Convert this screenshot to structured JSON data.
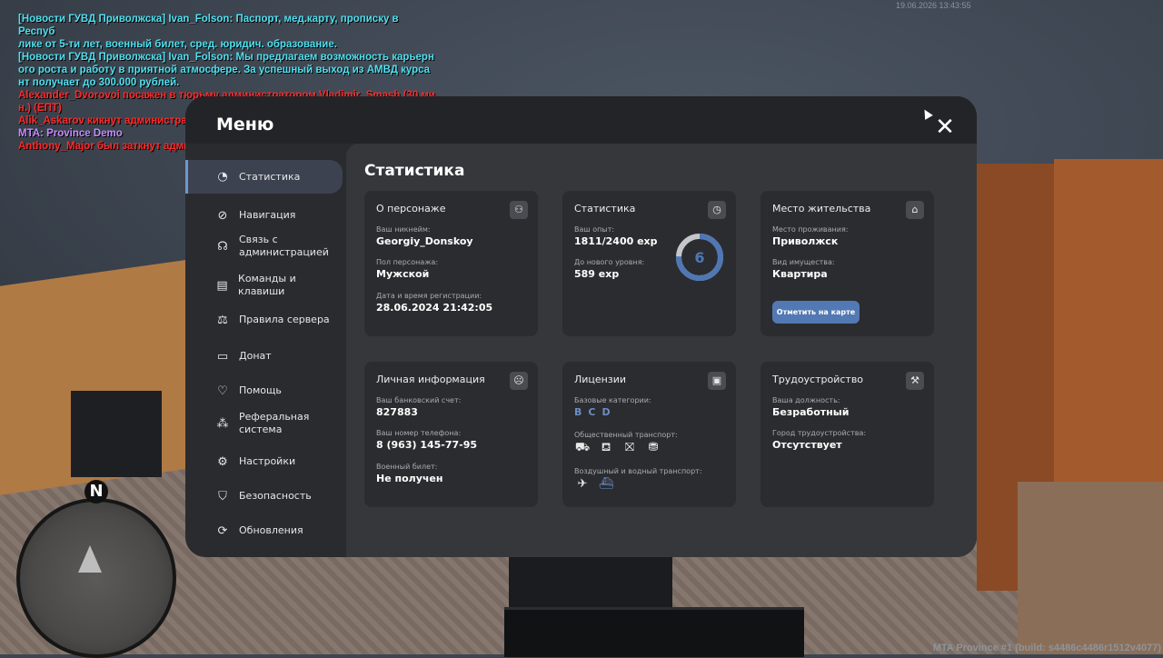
{
  "chat": [
    {
      "text": "[Новости ГУВД Приволжска] Ivan_Folson: Паспорт, мед.карту, прописку в Респуб",
      "color": "cyan"
    },
    {
      "text": "лике от 5-ти лет, военный билет, сред. юридич. образование.",
      "color": "cyan"
    },
    {
      "text": "[Новости ГУВД Приволжска] Ivan_Folson: Мы предлагаем возможность карьерн",
      "color": "cyan"
    },
    {
      "text": "ого роста и работу в приятной атмосфере. За успешный выход из АМВД курса",
      "color": "cyan"
    },
    {
      "text": "нт получает до 300.000 рублей.",
      "color": "cyan"
    },
    {
      "text": "Alexander_Dvorovoi посажен в тюрьму администратором Vladimir_Smash (30 ми",
      "color": "red"
    },
    {
      "text": "н.) (ЕПТ)",
      "color": "red"
    },
    {
      "text": "Alik_Askarov кикнут администратором Artem_Augustov (Сильные лаги)",
      "color": "red"
    },
    {
      "text": "MTA: Province Demo",
      "color": "purple"
    },
    {
      "text": "Anthony_Major был заткнут администратором Vladimir_Smash (30 мин.) (Caps)",
      "color": "red"
    }
  ],
  "top_time": "19.06.2026 13:43:55",
  "build": "MTA Province #1 (build: s4486c4486r1512v4077)",
  "radar": {
    "north": "N"
  },
  "menu": {
    "title": "Меню",
    "close": "✕"
  },
  "sidebar": {
    "items": [
      {
        "label": "Статистика",
        "icon": "pie-chart-icon",
        "glyph": "◔",
        "active": true
      },
      {
        "label": "Навигация",
        "icon": "compass-icon",
        "glyph": "⊘"
      },
      {
        "label": "Связь с\nадминистрацией",
        "icon": "headset-icon",
        "glyph": "☊"
      },
      {
        "label": "Команды и клавиши",
        "icon": "document-icon",
        "glyph": "▤"
      },
      {
        "label": "Правила сервера",
        "icon": "scales-icon",
        "glyph": "⚖"
      },
      {
        "label": "Донат",
        "icon": "wallet-icon",
        "glyph": "▭"
      },
      {
        "label": "Помощь",
        "icon": "heart-hand-icon",
        "glyph": "♡"
      },
      {
        "label": "Реферальная\nсистема",
        "icon": "network-icon",
        "glyph": "⁂"
      },
      {
        "label": "Настройки",
        "icon": "gear-icon",
        "glyph": "⚙"
      },
      {
        "label": "Безопасность",
        "icon": "shield-icon",
        "glyph": "⛉"
      },
      {
        "label": "Обновления",
        "icon": "refresh-check-icon",
        "glyph": "⟳"
      }
    ]
  },
  "content": {
    "title": "Статистика",
    "character": {
      "title": "О персонаже",
      "icon": "person-icon",
      "glyph": "⚇",
      "nick_label": "Ваш никнейм:",
      "nick": "Georgiy_Donskoy",
      "gender_label": "Пол персонажа:",
      "gender": "Мужской",
      "reg_label": "Дата и время регистрации:",
      "reg": "28.06.2024 21:42:05"
    },
    "stats": {
      "title": "Статистика",
      "icon": "clock-chart-icon",
      "glyph": "◷",
      "exp_label": "Ваш опыт:",
      "exp": "1811/2400 exp",
      "next_label": "До нового уровня:",
      "next": "589 exp",
      "level": "6",
      "progress": 0.7546,
      "ring_color": "#4f77b4",
      "track_color": "#c4c6cb"
    },
    "residence": {
      "title": "Место жительства",
      "icon": "home-icon",
      "glyph": "⌂",
      "place_label": "Место проживания:",
      "place": "Приволжск",
      "property_label": "Вид имущества:",
      "property": "Квартира",
      "map_button": "Отметить на карте"
    },
    "personal": {
      "title": "Личная информация",
      "icon": "face-icon",
      "glyph": "☹",
      "bank_label": "Ваш банковский счет:",
      "bank": "827883",
      "phone_label": "Ваш номер телефона:",
      "phone": "8 (963) 145-77-95",
      "military_label": "Военный билет:",
      "military": "Не получен"
    },
    "licenses": {
      "title": "Лицензии",
      "icon": "id-card-icon",
      "glyph": "▣",
      "base_label": "Базовые категории:",
      "base": [
        "B",
        "C",
        "D"
      ],
      "public_label": "Общественный транспорт:",
      "public_icons": [
        "bus-icon",
        "trolleybus-icon",
        "tram-icon",
        "metro-icon"
      ],
      "public_glyphs": [
        "⛟",
        "⛾",
        "⛝",
        "⛃"
      ],
      "air_label": "Воздушный и водный транспорт:",
      "air_icons": [
        "plane-icon",
        "boat-icon"
      ],
      "air_glyphs": [
        "✈",
        "⛴"
      ]
    },
    "job": {
      "title": "Трудоустройство",
      "icon": "tools-icon",
      "glyph": "⚒",
      "position_label": "Ваша должность:",
      "position": "Безработный",
      "city_label": "Город трудоустройства:",
      "city": "Отсутствует"
    }
  }
}
